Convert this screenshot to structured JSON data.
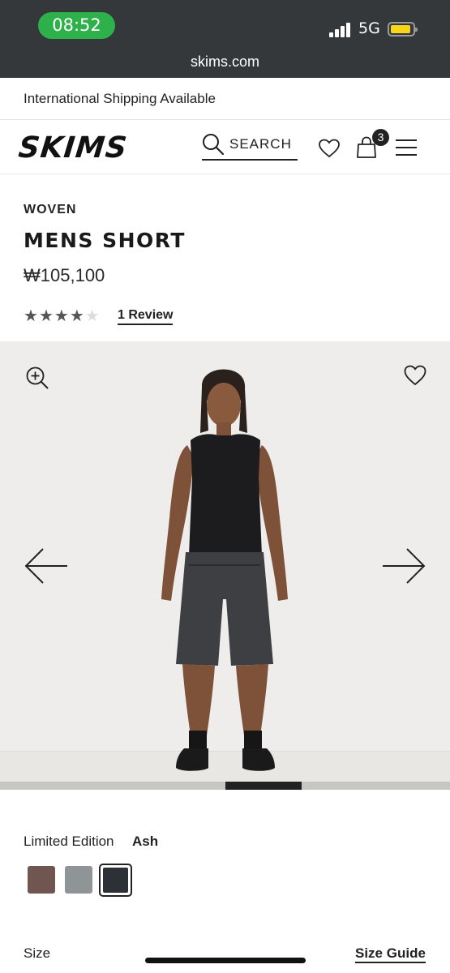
{
  "status_bar": {
    "time": "08:52",
    "network": "5G",
    "url": "skims.com",
    "colors": {
      "time_pill": "#2eb14b",
      "battery": "#f6d51b"
    }
  },
  "banner": {
    "text": "International Shipping Available"
  },
  "header": {
    "logo": "SKIMS",
    "search_label": "SEARCH",
    "cart_count": "3"
  },
  "product": {
    "category": "WOVEN",
    "title": "MENS SHORT",
    "price": "₩105,100",
    "rating": 4,
    "rating_max": 5,
    "review_link": "1 Review"
  },
  "gallery": {
    "progress_position": 0.5,
    "progress_fraction": 0.17
  },
  "color": {
    "label": "Limited Edition",
    "selected": "Ash",
    "swatches": [
      "#6f5650",
      "#8f9496",
      "#2e3037"
    ]
  },
  "size": {
    "label": "Size",
    "guide_link": "Size Guide"
  }
}
